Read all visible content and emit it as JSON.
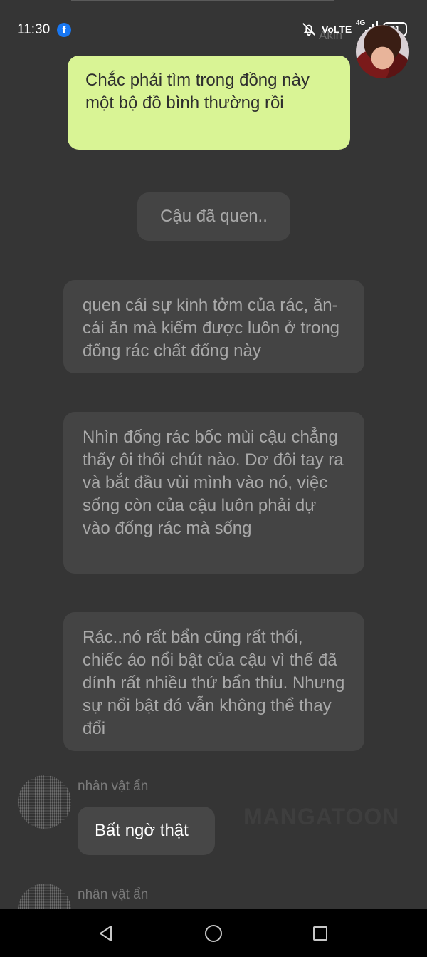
{
  "status_bar": {
    "time": "11:30",
    "volte": "VoLTE",
    "network": "4G",
    "battery": "81",
    "icons": [
      "facebook-icon",
      "bell-off-icon",
      "signal-icon",
      "battery-icon"
    ]
  },
  "chat": {
    "top_speaker_name": "Akin",
    "messages": [
      {
        "type": "speaker",
        "text": "Chắc phải tìm trong đồng này một bộ đồ bình thường rồi"
      },
      {
        "type": "narration",
        "text": "Cậu đã quen.."
      },
      {
        "type": "narration",
        "text": "quen cái sự kinh tởm của rác, ăn- cái ăn mà kiếm được luôn ở trong đống rác chất đống này"
      },
      {
        "type": "narration",
        "text": "Nhìn đống rác bốc mùi cậu chẳng thấy ôi thối chút nào. Dơ đôi tay ra và bắt đầu vùi mình vào nó, việc sống còn của cậu luôn phải dự vào đống rác mà sống"
      },
      {
        "type": "narration",
        "text": "Rác..nó rất bẩn cũng rất thối, chiếc áo nổi bật của cậu vì thế đã dính rất nhiều thứ bẩn thỉu. Nhưng sự nổi bật đó vẫn không thể thay đổi"
      },
      {
        "type": "character",
        "name": "nhân vật ẩn",
        "text": "Bất ngờ thật"
      },
      {
        "type": "character",
        "name": "nhân vật ẩn",
        "text": ""
      }
    ],
    "watermark": "MANGATOON"
  },
  "colors": {
    "background": "#353535",
    "speaker_bubble": "#d9f495",
    "narration_bubble": "#444444",
    "dialog_bubble": "#474747"
  }
}
